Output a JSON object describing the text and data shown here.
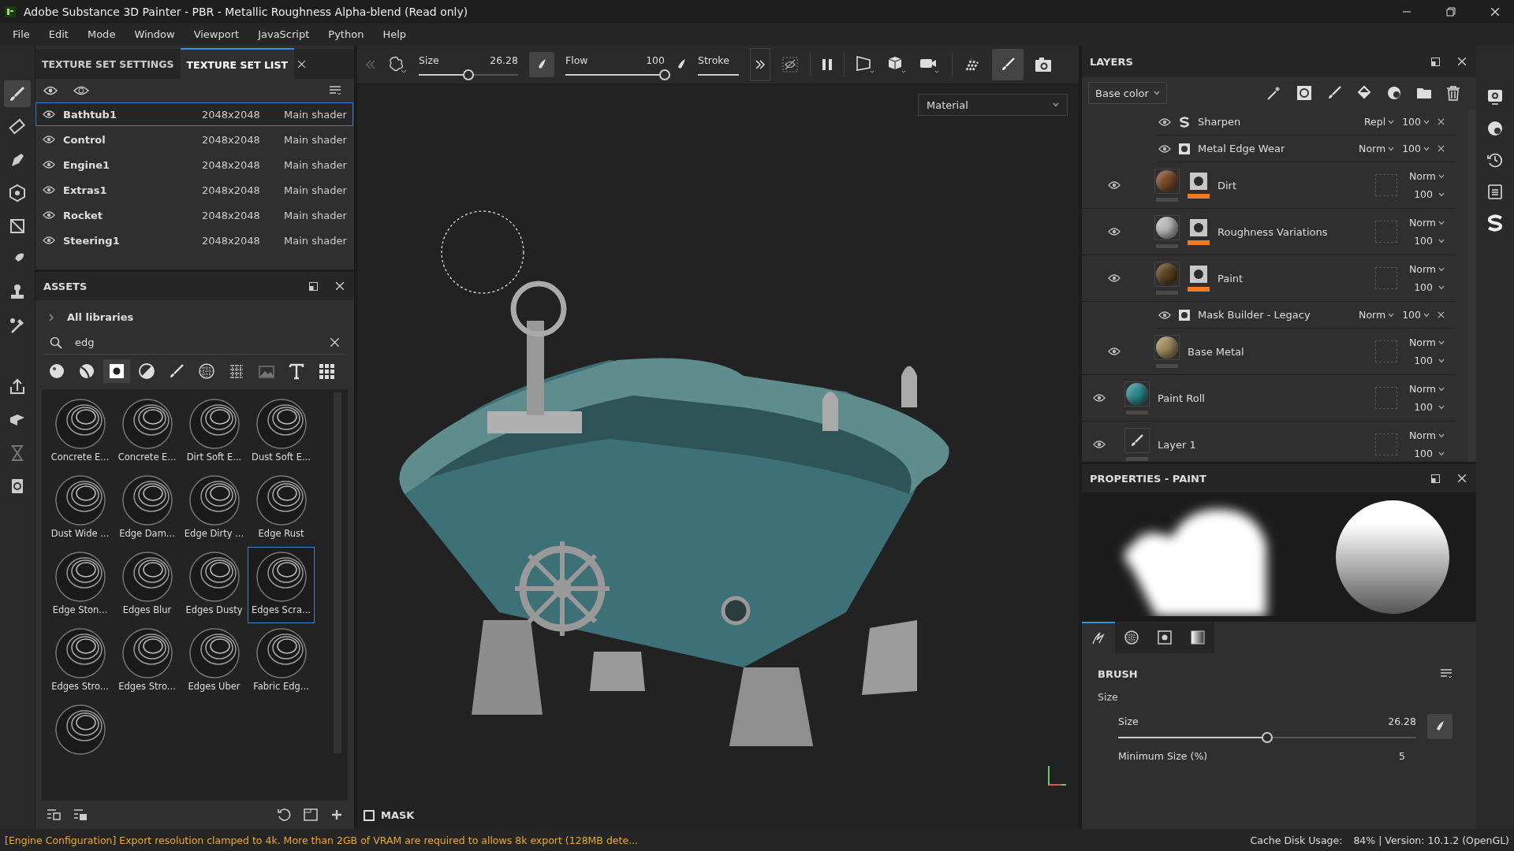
{
  "window": {
    "title": "Adobe Substance 3D Painter - PBR - Metallic Roughness Alpha-blend (Read only)"
  },
  "menu": [
    "File",
    "Edit",
    "Mode",
    "Window",
    "Viewport",
    "JavaScript",
    "Python",
    "Help"
  ],
  "texture_panel": {
    "tabs": [
      {
        "label": "TEXTURE SET SETTINGS",
        "selected": false
      },
      {
        "label": "TEXTURE SET LIST",
        "selected": true
      }
    ],
    "rows": [
      {
        "name": "Bathtub1",
        "resolution": "2048x2048",
        "shader": "Main shader",
        "selected": true
      },
      {
        "name": "Control",
        "resolution": "2048x2048",
        "shader": "Main shader",
        "selected": false
      },
      {
        "name": "Engine1",
        "resolution": "2048x2048",
        "shader": "Main shader",
        "selected": false
      },
      {
        "name": "Extras1",
        "resolution": "2048x2048",
        "shader": "Main shader",
        "selected": false
      },
      {
        "name": "Rocket",
        "resolution": "2048x2048",
        "shader": "Main shader",
        "selected": false
      },
      {
        "name": "Steering1",
        "resolution": "2048x2048",
        "shader": "Main shader",
        "selected": false
      }
    ]
  },
  "assets": {
    "title": "ASSETS",
    "library": "All libraries",
    "search": {
      "value": "edg"
    },
    "filters": [
      {
        "kind": "material",
        "selected": false
      },
      {
        "kind": "smart-material",
        "selected": false
      },
      {
        "kind": "mask",
        "selected": true
      },
      {
        "kind": "filter",
        "selected": false
      },
      {
        "kind": "brush",
        "selected": false
      },
      {
        "kind": "alpha",
        "selected": false
      },
      {
        "kind": "procedural",
        "selected": false
      },
      {
        "kind": "image",
        "selected": false
      },
      {
        "kind": "text",
        "selected": false
      },
      {
        "kind": "all",
        "selected": false
      }
    ],
    "items": [
      {
        "label": "Concrete E...",
        "selected": false
      },
      {
        "label": "Concrete E...",
        "selected": false
      },
      {
        "label": "Dirt Soft E...",
        "selected": false
      },
      {
        "label": "Dust Soft E...",
        "selected": false
      },
      {
        "label": "Dust Wide ...",
        "selected": false
      },
      {
        "label": "Edge Dam...",
        "selected": false
      },
      {
        "label": "Edge Dirty ...",
        "selected": false
      },
      {
        "label": "Edge Rust",
        "selected": false
      },
      {
        "label": "Edge Ston...",
        "selected": false
      },
      {
        "label": "Edges Blur",
        "selected": false
      },
      {
        "label": "Edges Dusty",
        "selected": false
      },
      {
        "label": "Edges Scra...",
        "selected": true
      },
      {
        "label": "Edges Stro...",
        "selected": false
      },
      {
        "label": "Edges Stro...",
        "selected": false
      },
      {
        "label": "Edges Uber",
        "selected": false
      },
      {
        "label": "Fabric Edg...",
        "selected": false
      },
      {
        "selected": false
      }
    ]
  },
  "toolbar": {
    "size": {
      "label": "Size",
      "value": "26.28",
      "level": 0.5
    },
    "flow": {
      "label": "Flow",
      "value": "100",
      "level": 1
    },
    "stroke": {
      "label": "Stroke"
    }
  },
  "viewport": {
    "mode": "Material",
    "mask_label": "MASK",
    "mask_checked": false
  },
  "layers_panel": {
    "title": "LAYERS",
    "channel": "Base color",
    "folder_children": [
      {
        "kind": "filter",
        "name": "Sharpen",
        "blend": "Repl",
        "opacity": "100"
      },
      {
        "kind": "generator",
        "name": "Metal Edge Wear",
        "blend": "Norm",
        "opacity": "100"
      },
      {
        "kind": "fill",
        "name": "Dirt",
        "color": "#7a4a2a",
        "mask": true,
        "blend": "Norm",
        "opacity": "100"
      },
      {
        "kind": "fill",
        "name": "Roughness Variations",
        "color": "#b8b8b8",
        "mask": true,
        "blend": "Norm",
        "opacity": "100"
      },
      {
        "kind": "fill",
        "name": "Paint",
        "color": "#5a4320",
        "mask": true,
        "blend": "Norm",
        "opacity": "100",
        "children": [
          {
            "kind": "generator",
            "name": "Mask Builder - Legacy",
            "blend": "Norm",
            "opacity": "100"
          }
        ]
      },
      {
        "kind": "fill",
        "name": "Base Metal",
        "color": "#a08a5c",
        "mask": false,
        "blend": "Norm",
        "opacity": "100"
      }
    ],
    "layers": [
      {
        "kind": "fill",
        "name": "Paint Roll",
        "color": "#2f8a90",
        "mask": false,
        "blend": "Norm",
        "opacity": "100"
      },
      {
        "kind": "paint",
        "name": "Layer 1",
        "mask": false,
        "blend": "Norm",
        "opacity": "100"
      }
    ]
  },
  "properties": {
    "title": "PROPERTIES - PAINT",
    "tabs": [
      {
        "kind": "brush",
        "selected": true
      },
      {
        "kind": "alpha",
        "selected": false
      },
      {
        "kind": "stencil",
        "selected": false
      },
      {
        "kind": "gradient",
        "selected": false
      }
    ],
    "section": "BRUSH",
    "group": "Size",
    "size": {
      "label": "Size",
      "value": "26.28",
      "level": 0.5
    },
    "min_size": {
      "label": "Minimum Size (%)",
      "value": "5"
    }
  },
  "status_bar": {
    "message": "[Engine Configuration] Export resolution clamped to 4k. More than 2GB of VRAM are required to allows 8k export (128MB dete...",
    "cache_label": "Cache Disk Usage:",
    "cache_value": "84% | Version: 10.1.2 (OpenGL)"
  }
}
